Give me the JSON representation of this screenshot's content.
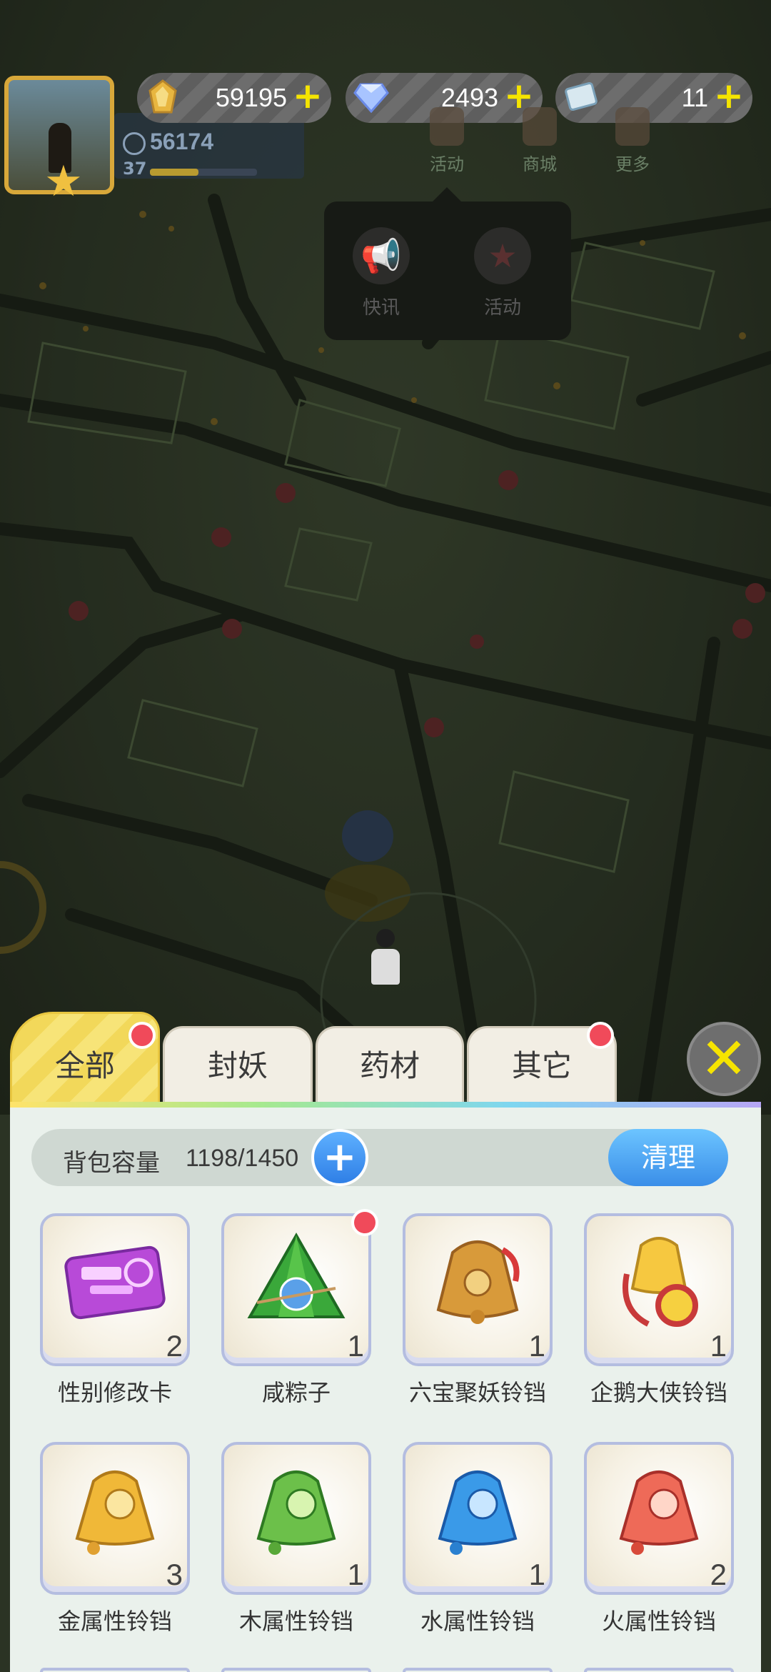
{
  "hud": {
    "power": "56174",
    "level": "37",
    "currencies": [
      {
        "icon": "gold-crystal-icon",
        "value": "59195"
      },
      {
        "icon": "diamond-icon",
        "value": "2493"
      },
      {
        "icon": "ticket-icon",
        "value": "11"
      }
    ],
    "buttons": [
      "活动",
      "商城",
      "更多"
    ],
    "popup_items": [
      "快讯",
      "活动"
    ]
  },
  "tabs": [
    {
      "label": "全部",
      "active": true,
      "badge": true
    },
    {
      "label": "封妖",
      "active": false,
      "badge": false
    },
    {
      "label": "药材",
      "active": false,
      "badge": false
    },
    {
      "label": "其它",
      "active": false,
      "badge": true
    }
  ],
  "capacity": {
    "label": "背包容量",
    "value": "1198/1450",
    "clean_label": "清理"
  },
  "items": [
    {
      "name": "性别修改卡",
      "count": "2",
      "icon": "gender-card-icon",
      "badge": false
    },
    {
      "name": "咸粽子",
      "count": "1",
      "icon": "zongzi-icon",
      "badge": true
    },
    {
      "name": "六宝聚妖铃铛",
      "count": "1",
      "icon": "golden-bell-icon",
      "badge": false
    },
    {
      "name": "企鹅大侠铃铛",
      "count": "1",
      "icon": "penguin-bell-icon",
      "badge": false
    },
    {
      "name": "金属性铃铛",
      "count": "3",
      "icon": "metal-bell-icon",
      "badge": false
    },
    {
      "name": "木属性铃铛",
      "count": "1",
      "icon": "wood-bell-icon",
      "badge": false
    },
    {
      "name": "水属性铃铛",
      "count": "1",
      "icon": "water-bell-icon",
      "badge": false
    },
    {
      "name": "火属性铃铛",
      "count": "2",
      "icon": "fire-bell-icon",
      "badge": false
    }
  ],
  "colors": {
    "accent_yellow": "#f6e400",
    "badge_red": "#f04a5a",
    "button_blue": "#3a8ee8"
  }
}
